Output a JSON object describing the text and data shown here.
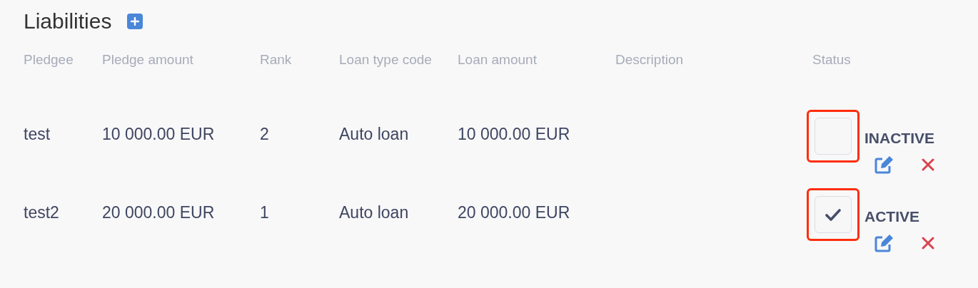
{
  "title": "Liabilities",
  "columns": [
    "Pledgee",
    "Pledge amount",
    "Rank",
    "Loan type code",
    "Loan amount",
    "Description",
    "Status"
  ],
  "rows": [
    {
      "pledgee": "test",
      "pledge_amount": "10 000.00 EUR",
      "rank": "2",
      "loan_type_code": "Auto loan",
      "loan_amount": "10 000.00 EUR",
      "status": "INACTIVE",
      "checked": false,
      "highlighted": true
    },
    {
      "pledgee": "test2",
      "pledge_amount": "20 000.00 EUR",
      "rank": "1",
      "loan_type_code": "Auto loan",
      "loan_amount": "20 000.00 EUR",
      "status": "ACTIVE",
      "checked": true,
      "highlighted": true
    }
  ]
}
